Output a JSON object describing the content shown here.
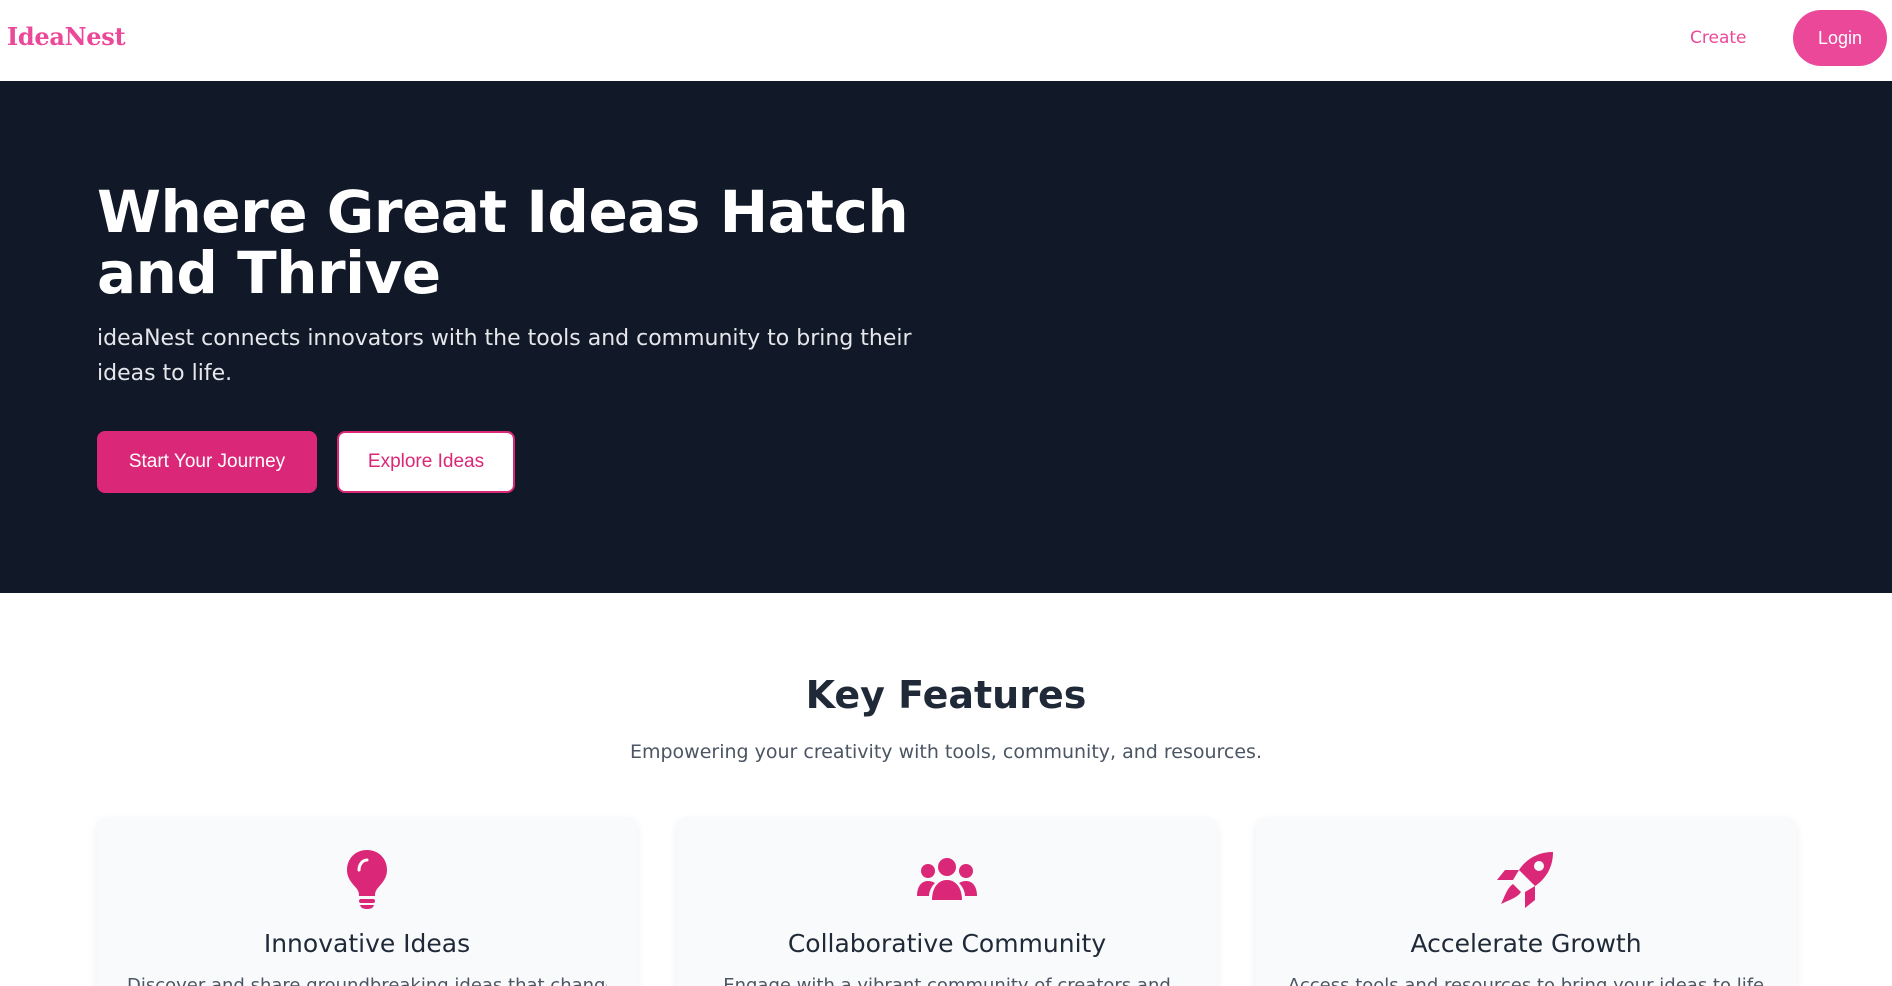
{
  "header": {
    "brand": "IdeaNest",
    "nav_create": "Create",
    "login_label": "Login"
  },
  "hero": {
    "title": "Where Great Ideas Hatch and Thrive",
    "subtitle": "ideaNest connects innovators with the tools and community to bring their ideas to life.",
    "primary_button": "Start Your Journey",
    "secondary_button": "Explore Ideas"
  },
  "features": {
    "title": "Key Features",
    "subtitle": "Empowering your creativity with tools, community, and resources.",
    "cards": [
      {
        "icon": "lightbulb-icon",
        "title": "Innovative Ideas",
        "description": "Discover and share groundbreaking ideas that change"
      },
      {
        "icon": "users-icon",
        "title": "Collaborative Community",
        "description": "Engage with a vibrant community of creators and"
      },
      {
        "icon": "rocket-icon",
        "title": "Accelerate Growth",
        "description": "Access tools and resources to bring your ideas to life"
      }
    ]
  },
  "colors": {
    "accent": "#ec4899",
    "accent_dark": "#db2777",
    "hero_bg": "#111827",
    "card_bg": "#f9fafb"
  }
}
